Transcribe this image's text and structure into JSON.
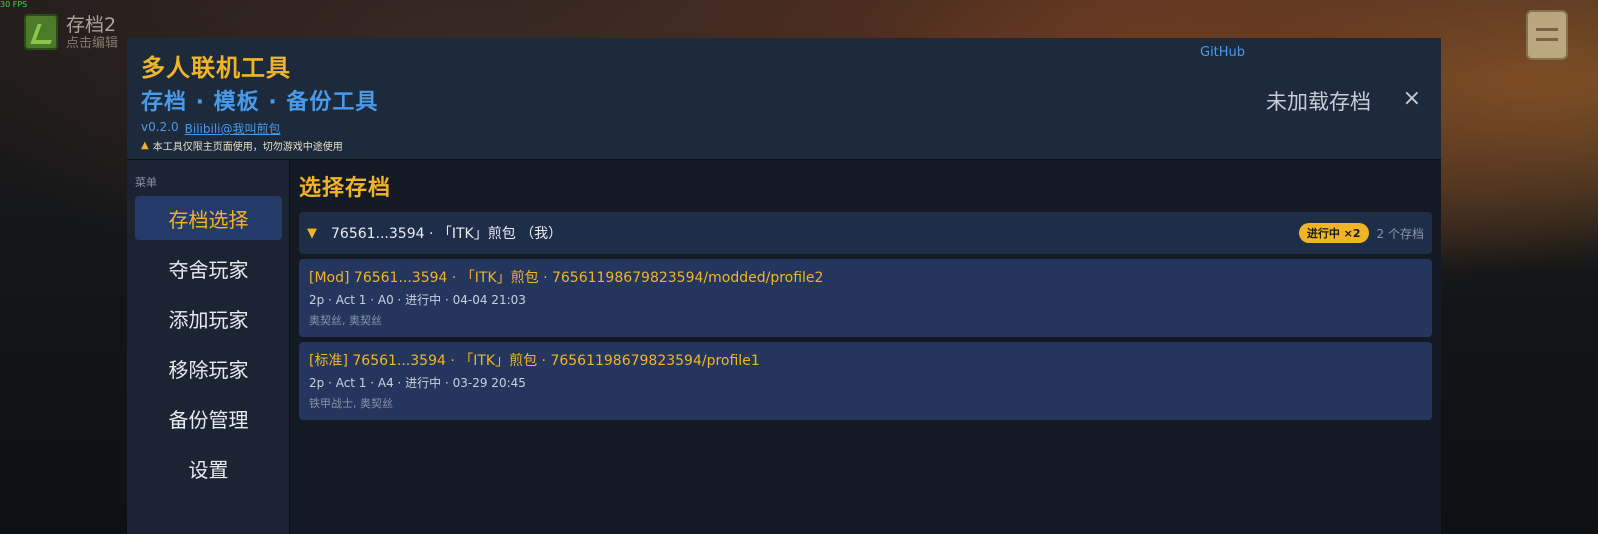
{
  "overlay": {
    "fps": "30 FPS"
  },
  "game": {
    "slot_name": "存档2",
    "slot_hint": "点击编辑"
  },
  "header": {
    "title": "多人联机工具",
    "subtitle": "存档 · 模板 · 备份工具",
    "version": "v0.2.0",
    "author_link": "Bilibili@我叫煎包",
    "warning": "本工具仅限主页面使用，切勿游戏中途使用",
    "github": "GitHub",
    "status": "未加载存档",
    "close": "×"
  },
  "sidebar": {
    "label": "菜单",
    "items": [
      {
        "label": "存档选择",
        "active": true
      },
      {
        "label": "夺舍玩家"
      },
      {
        "label": "添加玩家"
      },
      {
        "label": "移除玩家"
      },
      {
        "label": "备份管理"
      },
      {
        "label": "设置"
      }
    ]
  },
  "main": {
    "title": "选择存档",
    "group": {
      "chevron": "▼",
      "title": "76561...3594 · 「ITK」煎包 （我）",
      "badge": "进行中 ×2",
      "count": "2 个存档"
    },
    "saves": [
      {
        "title": "[Mod] 76561...3594 · 「ITK」煎包 · 76561198679823594/modded/profile2",
        "meta": "2p · Act 1 · A0 · 进行中 · 04-04 21:03",
        "chars": "奥契丝, 奥契丝"
      },
      {
        "title": "[标准] 76561...3594 · 「ITK」煎包 · 76561198679823594/profile1",
        "meta": "2p · Act 1 · A4 · 进行中 · 03-29 20:45",
        "chars": "铁甲战士, 奥契丝"
      }
    ]
  },
  "colors": {
    "accent": "#f0b428",
    "link": "#4a9ae8",
    "panel": "#141a24",
    "card": "#24365e"
  }
}
